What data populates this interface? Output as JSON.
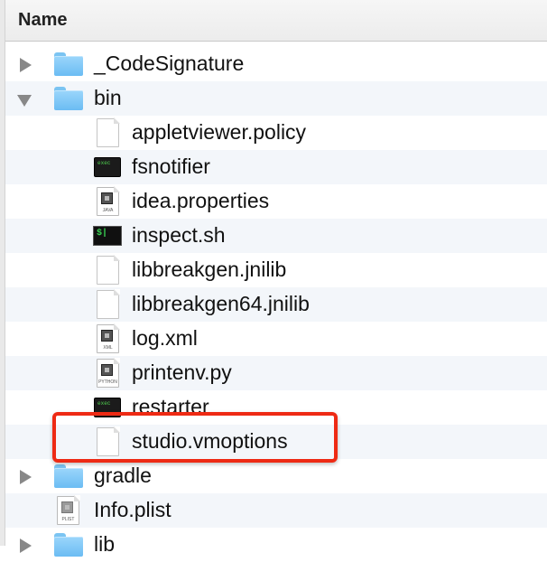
{
  "header": {
    "column_label": "Name"
  },
  "rows": [
    {
      "label": "_CodeSignature",
      "kind": "folder",
      "expanded": false
    },
    {
      "label": "bin",
      "kind": "folder",
      "expanded": true
    },
    {
      "label": "appletviewer.policy",
      "kind": "document"
    },
    {
      "label": "fsnotifier",
      "kind": "unix-executable"
    },
    {
      "label": "idea.properties",
      "kind": "file",
      "icon_caption": "JAVA"
    },
    {
      "label": "inspect.sh",
      "kind": "shell-script",
      "icon_text": "$|"
    },
    {
      "label": "libbreakgen.jnilib",
      "kind": "document"
    },
    {
      "label": "libbreakgen64.jnilib",
      "kind": "document"
    },
    {
      "label": "log.xml",
      "kind": "file",
      "icon_caption": "XML"
    },
    {
      "label": "printenv.py",
      "kind": "file",
      "icon_caption": "PYTHON"
    },
    {
      "label": "restarter",
      "kind": "unix-executable"
    },
    {
      "label": "studio.vmoptions",
      "kind": "document",
      "highlighted": true
    },
    {
      "label": "gradle",
      "kind": "folder",
      "expanded": false
    },
    {
      "label": "Info.plist",
      "kind": "file",
      "icon_caption": "PLIST"
    },
    {
      "label": "lib",
      "kind": "folder",
      "expanded": false
    }
  ],
  "exec_icon_text": "exec",
  "colors": {
    "highlight_border": "#ee2a14",
    "folder_blue": "#7bc4f2",
    "alt_row": "#f3f6fa"
  }
}
